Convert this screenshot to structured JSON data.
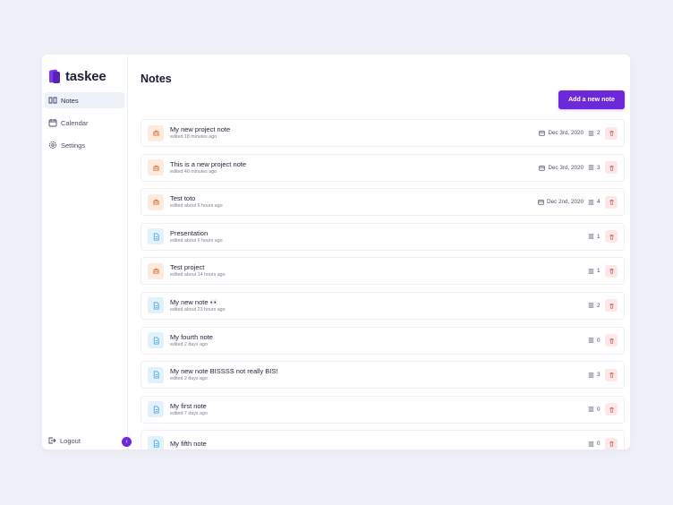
{
  "app": {
    "name": "taskee"
  },
  "sidebar": {
    "items": [
      {
        "label": "Notes",
        "icon": "book-icon",
        "active": true
      },
      {
        "label": "Calendar",
        "icon": "calendar-icon",
        "active": false
      },
      {
        "label": "Settings",
        "icon": "gear-icon",
        "active": false
      }
    ],
    "logout_label": "Logout",
    "collapse_icon": "‹"
  },
  "main": {
    "title": "Notes",
    "add_button_label": "Add a new note"
  },
  "notes": [
    {
      "title": "My new project note",
      "edited": "edited 18 minutes ago",
      "type": "project",
      "date": "Dec 3rd, 2020",
      "count": "2"
    },
    {
      "title": "This is a new project note",
      "edited": "edited 40 minutes ago",
      "type": "project",
      "date": "Dec 3rd, 2020",
      "count": "3"
    },
    {
      "title": "Test toto",
      "edited": "edited about 6 hours ago",
      "type": "project",
      "date": "Dec 2nd, 2020",
      "count": "4"
    },
    {
      "title": "Presentation",
      "edited": "edited about 6 hours ago",
      "type": "note",
      "date": "",
      "count": "1"
    },
    {
      "title": "Test project",
      "edited": "edited about 14 hours ago",
      "type": "project",
      "date": "",
      "count": "1"
    },
    {
      "title": "My new note 👀",
      "edited": "edited about 23 hours ago",
      "type": "note",
      "date": "",
      "count": "2"
    },
    {
      "title": "My fourth note",
      "edited": "edited 2 days ago",
      "type": "note",
      "date": "",
      "count": "0"
    },
    {
      "title": "My new note BISSSS not really BIS!",
      "edited": "edited 2 days ago",
      "type": "note",
      "date": "",
      "count": "3"
    },
    {
      "title": "My first note",
      "edited": "edited 7 days ago",
      "type": "note",
      "date": "",
      "count": "0"
    },
    {
      "title": "My fifth note",
      "edited": "",
      "type": "note",
      "date": "",
      "count": "0"
    }
  ],
  "colors": {
    "accent": "#6d28d9",
    "project_tile": "#fdebe0",
    "note_tile": "#e3f1fb",
    "delete_bg": "#fde8e8",
    "delete_icon": "#e05252"
  }
}
